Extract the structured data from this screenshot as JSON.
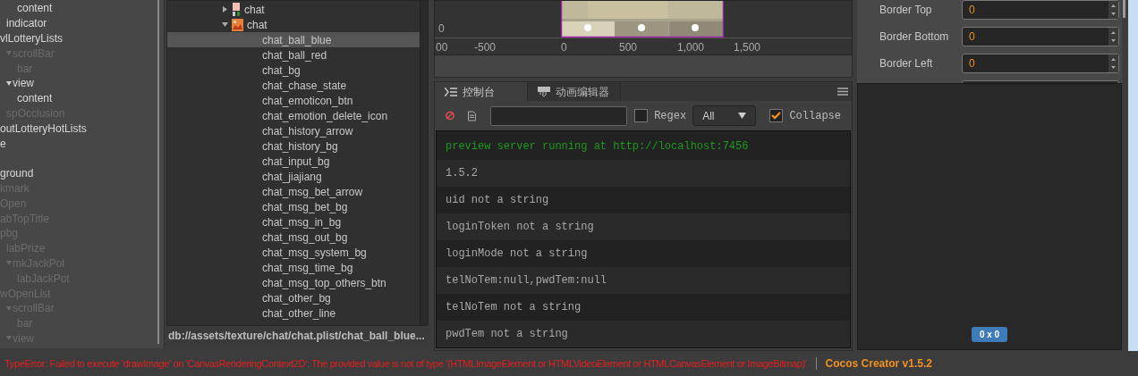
{
  "hierarchy": {
    "items": [
      {
        "children": [
          {
            "children": [
              {
                "label": "content",
                "active": true
              }
            ]
          },
          {
            "label": "indicator",
            "active": true
          }
        ]
      },
      {
        "label": "vlLotteryLists",
        "active": true,
        "children": [
          {
            "label": "scrollBar",
            "active": false,
            "expanded": true,
            "children": [
              {
                "label": "bar",
                "active": false
              }
            ]
          },
          {
            "label": "view",
            "active": true,
            "expanded": true,
            "children": [
              {
                "label": "content",
                "active": true
              }
            ]
          },
          {
            "label": "spOcclusion",
            "active": false
          }
        ]
      },
      {
        "label": "outLotteryHotLists",
        "active": true
      },
      {
        "label": "e",
        "active": true
      },
      {
        "kind": "blank"
      },
      {
        "label": "ground",
        "active": true
      },
      {
        "label": "kmark",
        "active": false
      },
      {
        "label": "Open",
        "active": false
      },
      {
        "label": "abTopTitle",
        "active": false
      },
      {
        "label": "pbg",
        "active": false,
        "children": [
          {
            "label": "labPrize",
            "active": false
          },
          {
            "label": "mkJackPot",
            "active": false,
            "expanded": true,
            "children": [
              {
                "label": "labJackPot",
                "active": false
              }
            ]
          }
        ]
      },
      {
        "label": "wOpenList",
        "active": false,
        "children": [
          {
            "label": "scrollBar",
            "active": false,
            "expanded": true,
            "children": [
              {
                "label": "bar",
                "active": false
              }
            ]
          },
          {
            "label": "view",
            "active": false,
            "expanded": true
          }
        ]
      }
    ]
  },
  "assets": {
    "folders": [
      {
        "label": "chat",
        "kind": "prefab",
        "expanded": false
      },
      {
        "label": "chat",
        "kind": "atlas",
        "expanded": true
      }
    ],
    "items": [
      {
        "label": "chat_ball_blue",
        "selected": true
      },
      {
        "label": "chat_ball_red",
        "selected": false
      },
      {
        "label": "chat_bg",
        "selected": false
      },
      {
        "label": "chat_chase_state",
        "selected": false
      },
      {
        "label": "chat_emoticon_btn",
        "selected": false
      },
      {
        "label": "chat_emotion_delete_icon",
        "selected": false
      },
      {
        "label": "chat_history_arrow",
        "selected": false
      },
      {
        "label": "chat_history_bg",
        "selected": false
      },
      {
        "label": "chat_input_bg",
        "selected": false
      },
      {
        "label": "chat_jiajiang",
        "selected": false
      },
      {
        "label": "chat_msg_bet_arrow",
        "selected": false
      },
      {
        "label": "chat_msg_bet_bg",
        "selected": false
      },
      {
        "label": "chat_msg_in_bg",
        "selected": false
      },
      {
        "label": "chat_msg_out_bg",
        "selected": false
      },
      {
        "label": "chat_msg_system_bg",
        "selected": false
      },
      {
        "label": "chat_msg_time_bg",
        "selected": false
      },
      {
        "label": "chat_msg_top_others_btn",
        "selected": false
      },
      {
        "label": "chat_other_bg",
        "selected": false
      },
      {
        "label": "chat_other_line",
        "selected": false
      }
    ],
    "path": "db://assets/texture/chat/chat.plist/chat_ball_blue..."
  },
  "scene": {
    "y_ruler": "0",
    "x_ruler": [
      "00",
      "-500",
      "0",
      "500",
      "1,000",
      "1,500"
    ]
  },
  "console": {
    "tabs": [
      {
        "label": "控制台",
        "kind": "console",
        "selected": true
      },
      {
        "label": "动画编辑器",
        "kind": "animation",
        "selected": false
      }
    ],
    "regex": {
      "label": "Regex",
      "checked": false
    },
    "level": "All",
    "collapse": {
      "label": "Collapse",
      "checked": true
    },
    "logs": [
      {
        "text": "preview server running at http://localhost:7456",
        "kind": "success"
      },
      {
        "text": "1.5.2",
        "kind": "log"
      },
      {
        "text": "uid not a string",
        "kind": "log"
      },
      {
        "text": "loginToken not a string",
        "kind": "log"
      },
      {
        "text": "loginMode not a string",
        "kind": "log"
      },
      {
        "text": "telNoTem:null,pwdTem:null",
        "kind": "log"
      },
      {
        "text": "telNoTem not a string",
        "kind": "log"
      },
      {
        "text": "pwdTem not a string",
        "kind": "log"
      }
    ]
  },
  "inspector": {
    "props": [
      {
        "label": "Border Top",
        "value": "0"
      },
      {
        "label": "Border Bottom",
        "value": "0"
      },
      {
        "label": "Border Left",
        "value": "0"
      }
    ],
    "preview_size": "0 x 0"
  },
  "status_bar": {
    "error": "TypeError: Failed to execute 'drawImage' on 'CanvasRenderingContext2D': The provided value is not of type '(HTMLImageElement or HTMLVideoElement or HTMLCanvasElement or ImageBitmap)'",
    "version": "Cocos Creator v1.5.2"
  }
}
